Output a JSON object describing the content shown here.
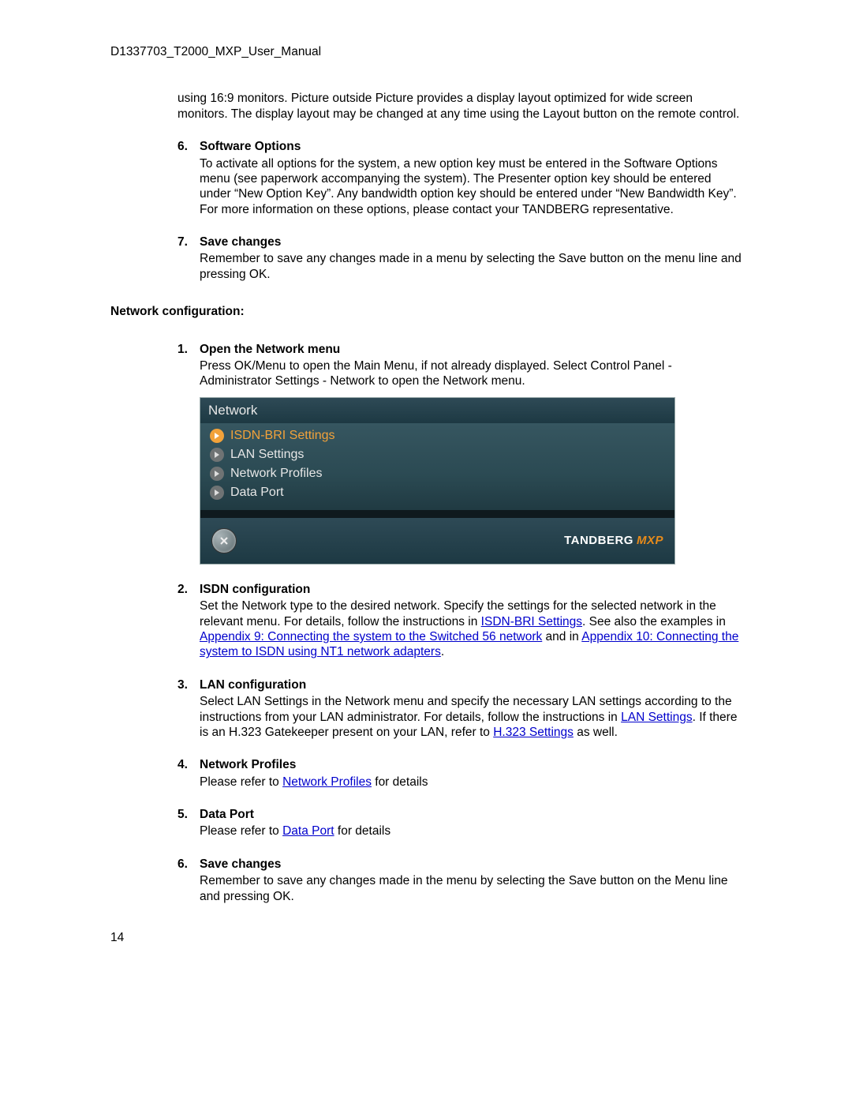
{
  "header": "D1337703_T2000_MXP_User_Manual",
  "page_number": "14",
  "intro_para": "using 16:9 monitors. Picture outside Picture provides a display layout optimized for wide screen monitors. The display layout may be changed at any time using the Layout button on the remote control.",
  "gen_list": [
    {
      "num": "6.",
      "title": "Software Options",
      "body": "To activate all options for the system, a new option key must be entered in the Software Options menu (see paperwork accompanying the system). The Presenter option key should be entered under “New Option Key”. Any bandwidth option key should be entered under “New Bandwidth Key”. For more information on these options, please contact your TANDBERG representative."
    },
    {
      "num": "7.",
      "title": "Save changes",
      "body": "Remember to save any changes made in a menu by selecting the Save button on the menu line and pressing OK."
    }
  ],
  "net_section_title": "Network configuration:",
  "net1": {
    "num": "1.",
    "title": "Open the Network menu",
    "body": "Press OK/Menu to open the Main Menu, if not already displayed. Select Control Panel - Administrator Settings - Network to open the Network menu."
  },
  "menu": {
    "title": "Network",
    "items": [
      "ISDN-BRI Settings",
      "LAN Settings",
      "Network Profiles",
      "Data Port"
    ],
    "brand_a": "TANDBERG",
    "brand_b": "MXP"
  },
  "net2": {
    "num": "2.",
    "title": "ISDN configuration",
    "pre": "Set the Network type to the desired network. Specify the settings for the selected network in the relevant menu. For details, follow the instructions in ",
    "link1": "ISDN-BRI Settings",
    "mid1": ". See also the examples in ",
    "link2": "Appendix 9: Connecting the system to the Switched 56 network",
    "mid2": " and in ",
    "link3": "Appendix 10: Connecting the system to ISDN using NT1 network adapters",
    "post": "."
  },
  "net3": {
    "num": "3.",
    "title": "LAN configuration",
    "pre": "Select LAN Settings in the Network menu and specify the necessary LAN settings according to the instructions from your LAN administrator. For details, follow the instructions in ",
    "link1": "LAN Settings",
    "mid1": ". If there is an H.323 Gatekeeper present on your LAN, refer to ",
    "link2": "H.323 Settings",
    "post": " as well."
  },
  "net4": {
    "num": "4.",
    "title": "Network Profiles",
    "pre": "Please refer to ",
    "link1": "Network Profiles",
    "post": " for details"
  },
  "net5": {
    "num": "5.",
    "title": "Data Port",
    "pre": "Please refer to ",
    "link1": "Data Port",
    "post": " for details"
  },
  "net6": {
    "num": "6.",
    "title": "Save changes",
    "body": "Remember to save any changes made in the menu by selecting the Save button on the Menu line and pressing OK."
  }
}
